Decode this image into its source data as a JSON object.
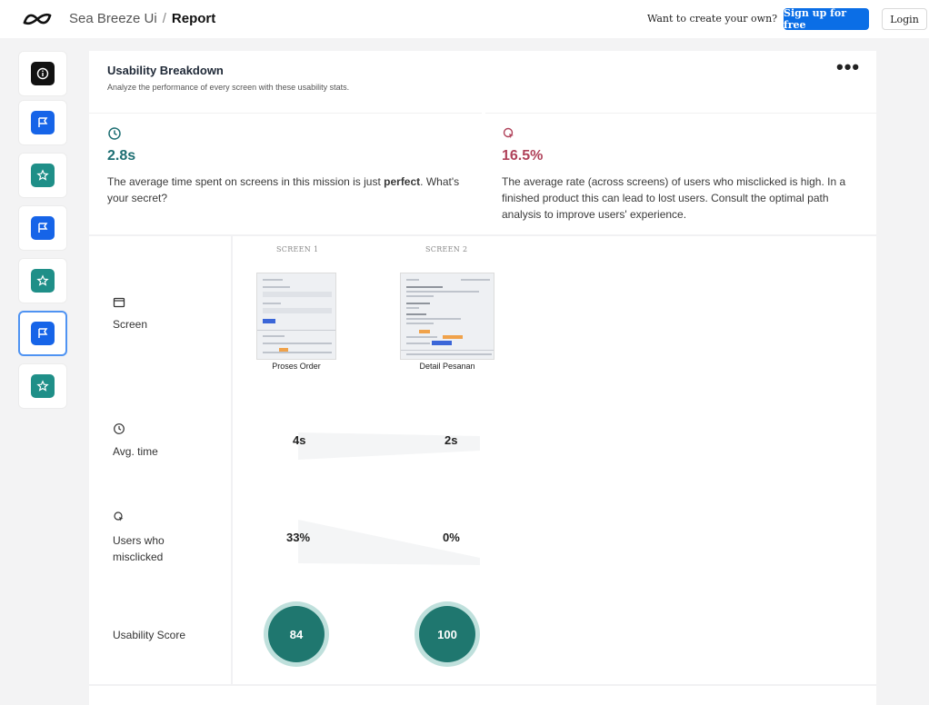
{
  "topbar": {
    "logo_icon": "infinity-logo-icon",
    "project": "Sea Breeze Ui",
    "separator": "/",
    "page": "Report",
    "cta_text": "Want to create your own?",
    "signup_label": "Sign up for free",
    "login_label": "Login"
  },
  "rail": {
    "items": [
      {
        "icon": "info-icon",
        "active": false
      },
      {
        "icon": "flag-icon",
        "active": false
      },
      {
        "icon": "star-icon",
        "active": false
      },
      {
        "icon": "flag-icon",
        "active": false
      },
      {
        "icon": "star-icon",
        "active": false
      },
      {
        "icon": "flag-icon",
        "active": true
      },
      {
        "icon": "star-icon",
        "active": false
      }
    ]
  },
  "card": {
    "title": "Usability Breakdown",
    "subtitle": "Analyze the performance of every screen with these usability stats.",
    "menu_icon": "more-dots-icon"
  },
  "stats": {
    "time": {
      "icon": "clock-icon",
      "value": "2.8s",
      "desc_before": "The average time spent on screens in this mission is just ",
      "desc_emph": "perfect",
      "desc_after": ". What's your secret?"
    },
    "misclick": {
      "icon": "misclick-cursor-icon",
      "value": "16.5%",
      "desc": "The average rate (across screens) of users who misclicked is high. In a finished product this can lead to lost users. Consult the optimal path analysis to improve users' experience."
    }
  },
  "rows": {
    "screen": {
      "icon": "screen-icon",
      "label": "Screen"
    },
    "avg_time": {
      "icon": "clock-icon",
      "label": "Avg. time"
    },
    "misclicked": {
      "icon": "misclick-cursor-icon",
      "label_line1": "Users who",
      "label_line2": "misclicked"
    },
    "score": {
      "label": "Usability Score"
    }
  },
  "screens": [
    {
      "header": "SCREEN 1",
      "name": "Proses Order",
      "avg_time": "4s",
      "misclick": "33%",
      "score": "84"
    },
    {
      "header": "SCREEN 2",
      "name": "Detail Pesanan",
      "avg_time": "2s",
      "misclick": "0%",
      "score": "100"
    }
  ],
  "colors": {
    "accent_blue": "#0b6ee6",
    "teal": "#1f776f",
    "misclick_red": "#b0425a"
  }
}
